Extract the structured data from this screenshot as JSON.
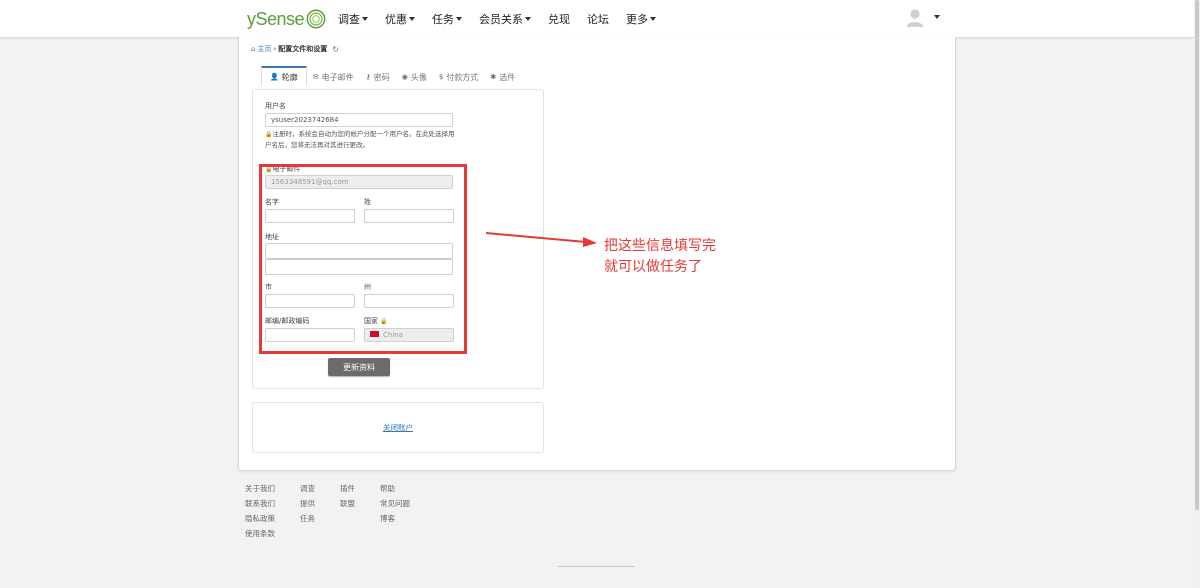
{
  "navbar": {
    "logo_text": "ySense",
    "items": [
      {
        "label": "调查",
        "has_caret": true
      },
      {
        "label": "优惠",
        "has_caret": true
      },
      {
        "label": "任务",
        "has_caret": true
      },
      {
        "label": "会员关系",
        "has_caret": true
      },
      {
        "label": "兑现",
        "has_caret": false
      },
      {
        "label": "论坛",
        "has_caret": false
      },
      {
        "label": "更多",
        "has_caret": true
      }
    ]
  },
  "breadcrumb": {
    "home": "主页",
    "separator": "›",
    "current": "配置文件和设置"
  },
  "tabs": [
    {
      "label": "轮廓",
      "icon": "user-icon",
      "glyph": "👤",
      "active": true
    },
    {
      "label": "电子邮件",
      "icon": "envelope-icon",
      "glyph": "✉",
      "active": false
    },
    {
      "label": "密码",
      "icon": "key-icon",
      "glyph": "⚷",
      "active": false
    },
    {
      "label": "头像",
      "icon": "user-circle-icon",
      "glyph": "◉",
      "active": false
    },
    {
      "label": "付款方式",
      "icon": "dollar-icon",
      "glyph": "$",
      "active": false
    },
    {
      "label": "选件",
      "icon": "gear-icon",
      "glyph": "✱",
      "active": false
    }
  ],
  "profile": {
    "username_label": "用户名",
    "username_value": "ysuser2023742684",
    "username_help": "注册时，系统会自动为您的帐户分配一个用户名。在此处选择用户名后，您将无法再对其进行更改。",
    "email_label": "电子邮件",
    "email_value": "1563348591@qq.com",
    "first_name_label": "名字",
    "last_name_label": "姓",
    "address_label": "地址",
    "city_label": "市",
    "state_label": "州",
    "zip_label": "邮编/邮政编码",
    "country_label": "国家",
    "country_value": "China",
    "update_button": "更新资料"
  },
  "close_account": "关闭账户",
  "annotation": {
    "line1": "把这些信息填写完",
    "line2": "就可以做任务了",
    "color": "#e53935"
  },
  "footer": {
    "col1": [
      "关于我们",
      "联系我们",
      "隐私政策",
      "使用条款"
    ],
    "col2": [
      "调查",
      "提供",
      "任务"
    ],
    "col3": [
      "插件",
      "联盟"
    ],
    "col4": [
      "帮助",
      "常见问题",
      "博客"
    ]
  },
  "colors": {
    "brand_green": "#5a9e3a",
    "link_blue": "#337ab7",
    "button_gray": "#6b6b6b"
  }
}
